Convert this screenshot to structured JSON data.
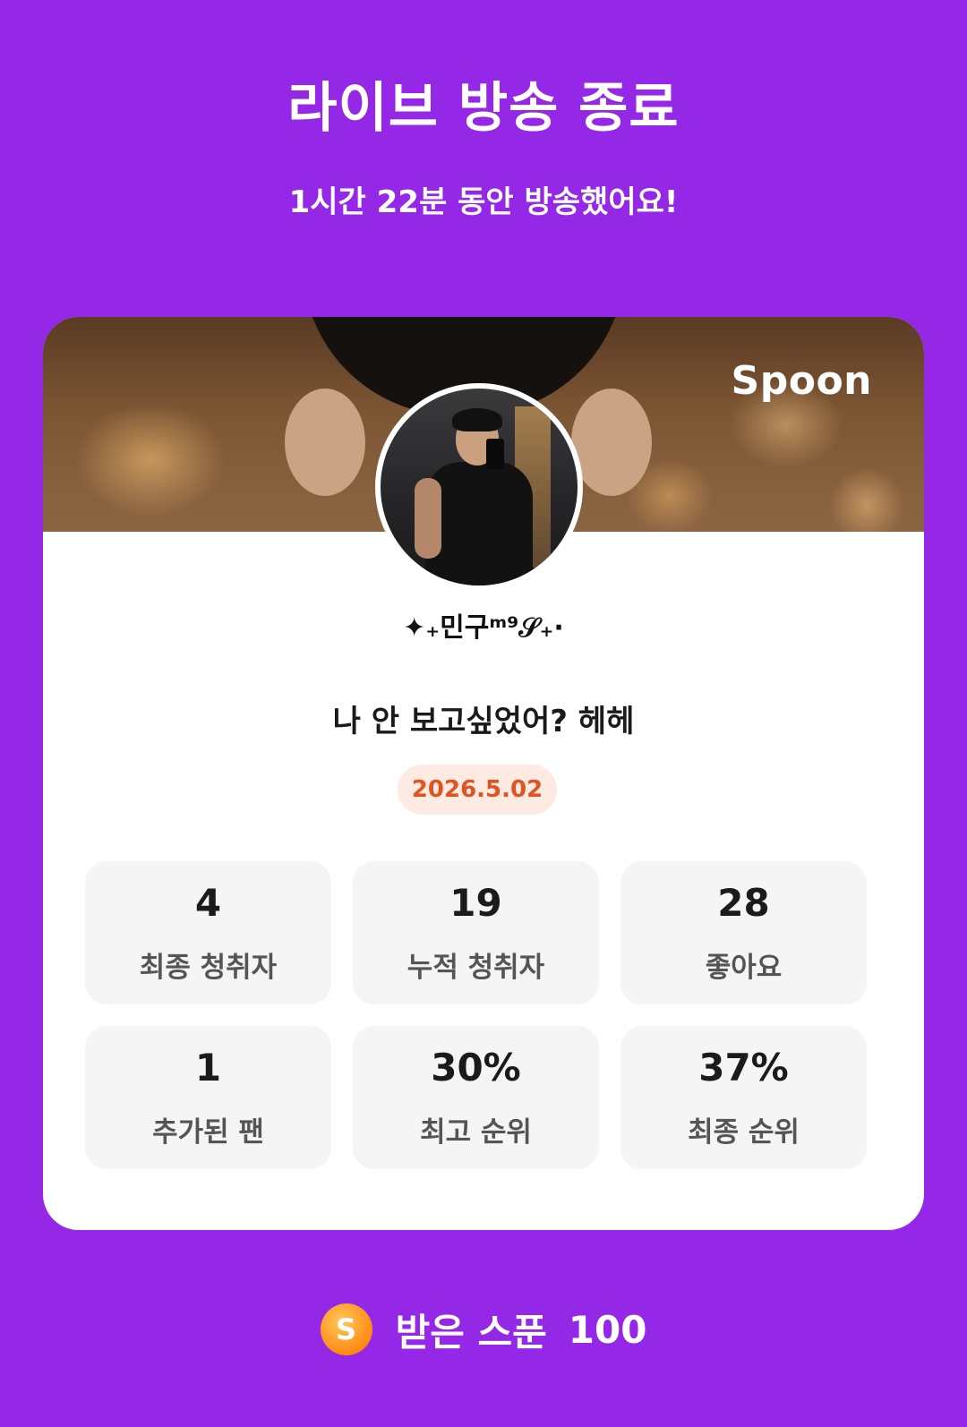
{
  "header": {
    "title": "라이브 방송 종료",
    "subtitle": "1시간 22분 동안 방송했어요!"
  },
  "card": {
    "brand": "Spoon",
    "nickname": "✦₊민구ᵐ⁹𝒮₊·",
    "live_title": "나 안 보고싶었어? 헤헤",
    "date": "2026.5.02",
    "stats": [
      {
        "value": "4",
        "label": "최종 청취자"
      },
      {
        "value": "19",
        "label": "누적 청취자"
      },
      {
        "value": "28",
        "label": "좋아요"
      },
      {
        "value": "1",
        "label": "추가된 팬"
      },
      {
        "value": "30%",
        "label": "최고 순위"
      },
      {
        "value": "37%",
        "label": "최종 순위"
      }
    ]
  },
  "footer": {
    "coin_icon": "spoon-coin-icon",
    "coin_glyph": "S",
    "label": "받은 스푼",
    "value": "100"
  },
  "colors": {
    "background": "#9527E6",
    "accent_date": "#E1531F",
    "date_pill": "#FDEAE3",
    "coin": "#FF8A14"
  }
}
